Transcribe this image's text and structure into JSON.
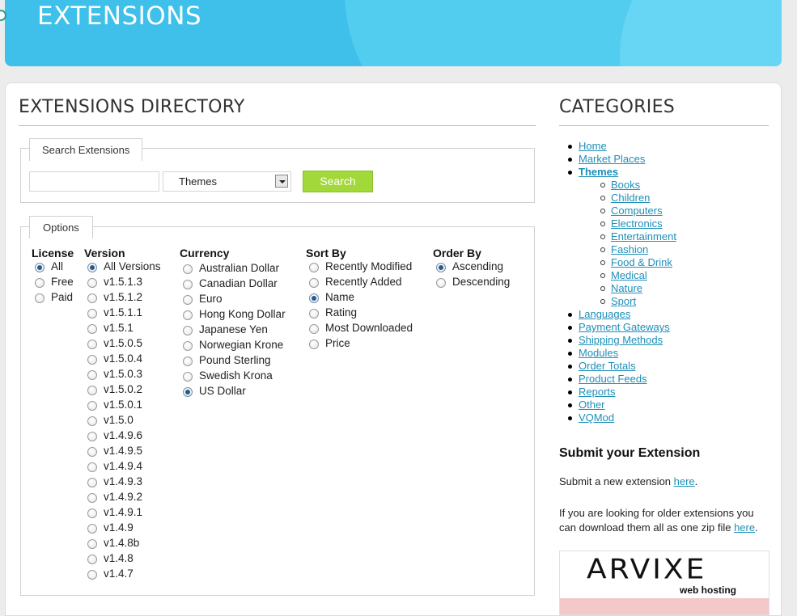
{
  "header": {
    "logo_text": "EXTENSIONS"
  },
  "main": {
    "title": "EXTENSIONS DIRECTORY",
    "search": {
      "legend": "Search Extensions",
      "input_value": "",
      "select_value": "Themes",
      "button_label": "Search"
    },
    "options": {
      "legend": "Options",
      "license": {
        "heading": "License",
        "items": [
          "All",
          "Free",
          "Paid"
        ],
        "selected": "All"
      },
      "version": {
        "heading": "Version",
        "items": [
          "All Versions",
          "v1.5.1.3",
          "v1.5.1.2",
          "v1.5.1.1",
          "v1.5.1",
          "v1.5.0.5",
          "v1.5.0.4",
          "v1.5.0.3",
          "v1.5.0.2",
          "v1.5.0.1",
          "v1.5.0",
          "v1.4.9.6",
          "v1.4.9.5",
          "v1.4.9.4",
          "v1.4.9.3",
          "v1.4.9.2",
          "v1.4.9.1",
          "v1.4.9",
          "v1.4.8b",
          "v1.4.8",
          "v1.4.7"
        ],
        "selected": "All Versions"
      },
      "currency": {
        "heading": "Currency",
        "items": [
          "Australian Dollar",
          "Canadian Dollar",
          "Euro",
          "Hong Kong Dollar",
          "Japanese Yen",
          "Norwegian Krone",
          "Pound Sterling",
          "Swedish Krona",
          "US Dollar"
        ],
        "selected": "US Dollar"
      },
      "sort_by": {
        "heading": "Sort By",
        "items": [
          "Recently Modified",
          "Recently Added",
          "Name",
          "Rating",
          "Most Downloaded",
          "Price"
        ],
        "selected": "Name"
      },
      "order_by": {
        "heading": "Order By",
        "items": [
          "Ascending",
          "Descending"
        ],
        "selected": "Ascending"
      }
    }
  },
  "sidebar": {
    "title": "CATEGORIES",
    "categories": [
      {
        "label": "Home"
      },
      {
        "label": "Market Places"
      },
      {
        "label": "Themes",
        "active": true,
        "children": [
          "Books",
          "Children",
          "Computers",
          "Electronics",
          "Entertainment",
          "Fashion",
          "Food & Drink",
          "Medical",
          "Nature",
          "Sport"
        ]
      },
      {
        "label": "Languages"
      },
      {
        "label": "Payment Gateways"
      },
      {
        "label": "Shipping Methods"
      },
      {
        "label": "Modules"
      },
      {
        "label": "Order Totals"
      },
      {
        "label": "Product Feeds"
      },
      {
        "label": "Reports"
      },
      {
        "label": "Other"
      },
      {
        "label": "VQMod"
      }
    ],
    "submit": {
      "title": "Submit your Extension",
      "p1_text": "Submit a new extension ",
      "p1_link": "here",
      "p1_end": ".",
      "p2_text": "If you are looking for older extensions you can download them all as one zip file ",
      "p2_link": "here",
      "p2_end": "."
    },
    "ad": {
      "logo": "ARVIXE",
      "tagline": "web hosting"
    }
  }
}
